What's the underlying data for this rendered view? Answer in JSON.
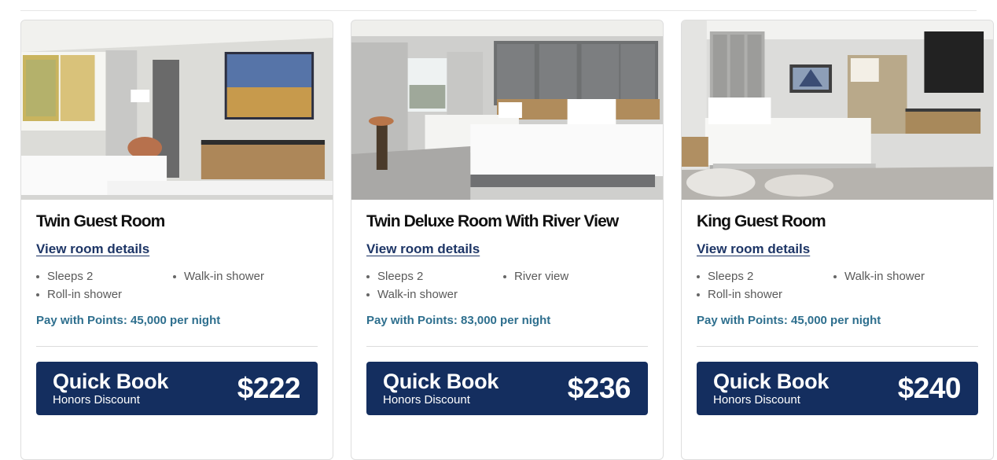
{
  "rooms": [
    {
      "title": "Twin Guest Room",
      "details_link": "View room details",
      "amenities": [
        "Sleeps 2",
        "Walk-in shower",
        "Roll-in shower"
      ],
      "points": "Pay with Points: 45,000 per night",
      "quick_book": "Quick Book",
      "discount": "Honors Discount",
      "price": "$222"
    },
    {
      "title": "Twin Deluxe Room With River View",
      "details_link": "View room details",
      "amenities": [
        "Sleeps 2",
        "River view",
        "Walk-in shower"
      ],
      "points": "Pay with Points: 83,000 per night",
      "quick_book": "Quick Book",
      "discount": "Honors Discount",
      "price": "$236"
    },
    {
      "title": "King Guest Room",
      "details_link": "View room details",
      "amenities": [
        "Sleeps 2",
        "Walk-in shower",
        "Roll-in shower"
      ],
      "points": "Pay with Points: 45,000 per night",
      "quick_book": "Quick Book",
      "discount": "Honors Discount",
      "price": "$240"
    }
  ],
  "colors": {
    "button_bg": "#142e5f",
    "link": "#1d3566",
    "points_text": "#2e6f8e"
  }
}
